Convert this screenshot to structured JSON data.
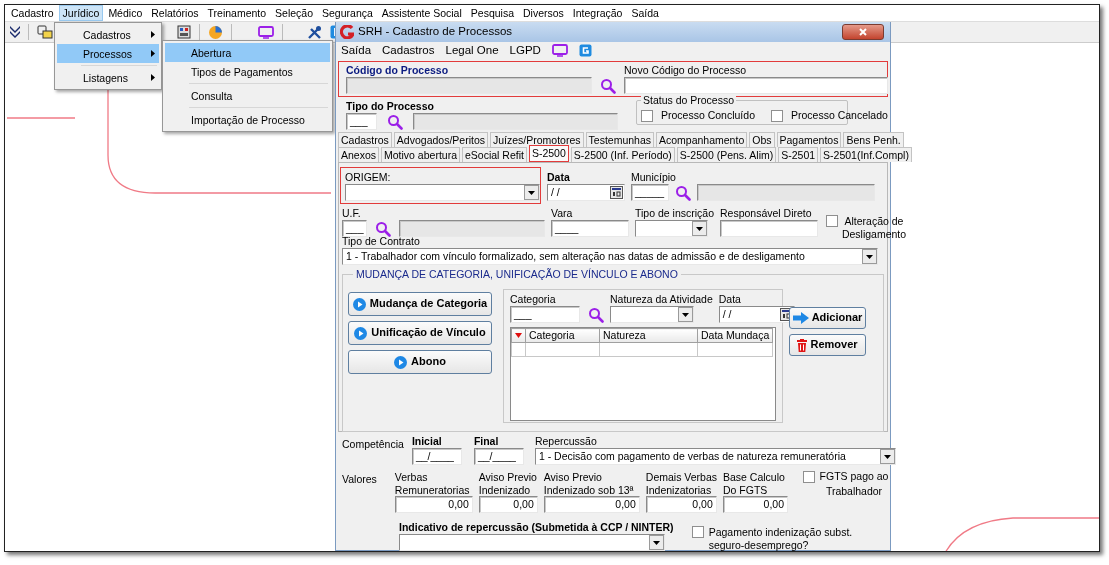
{
  "menubar": [
    {
      "label": "Cadastro",
      "selected": false
    },
    {
      "label": "Jurídico",
      "selected": true
    },
    {
      "label": "Médico",
      "selected": false
    },
    {
      "label": "Relatórios",
      "selected": false
    },
    {
      "label": "Treinamento",
      "selected": false
    },
    {
      "label": "Seleção",
      "selected": false
    },
    {
      "label": "Segurança",
      "selected": false
    },
    {
      "label": "Assistente Social",
      "selected": false
    },
    {
      "label": "Pesquisa",
      "selected": false
    },
    {
      "label": "Diversos",
      "selected": false
    },
    {
      "label": "Integração",
      "selected": false
    },
    {
      "label": "Saída",
      "selected": false
    }
  ],
  "menu": {
    "items": [
      {
        "kind": "item",
        "label": "Cadastros",
        "selected": false
      },
      {
        "kind": "item",
        "label": "Processos",
        "selected": true
      },
      {
        "kind": "separator"
      },
      {
        "kind": "item",
        "label": "Listagens",
        "selected": false
      }
    ]
  },
  "submenu": {
    "items": [
      {
        "kind": "item",
        "label": "Abertura",
        "selected": true
      },
      {
        "kind": "item",
        "label": "Tipos de Pagamentos",
        "selected": false
      },
      {
        "kind": "separator"
      },
      {
        "kind": "item",
        "label": "Consulta",
        "selected": false
      },
      {
        "kind": "separator"
      },
      {
        "kind": "item",
        "label": "Importação de Processo",
        "selected": false
      }
    ]
  },
  "dialog": {
    "title": "SRH - Cadastro de Processos",
    "menu": [
      "Saída",
      "Cadastros",
      "Legal One",
      "LGPD"
    ],
    "codigo": {
      "label": "Código do Processo",
      "highlighted": true
    },
    "novo_codigo": {
      "label": "Novo Código do Processo"
    },
    "tipo_processo": {
      "label": "Tipo do Processo",
      "value": "___"
    },
    "status": {
      "title": "Status do Processo",
      "options": [
        {
          "label": "Processo Concluído",
          "checked": false
        },
        {
          "label": "Processo Cancelado",
          "checked": false
        }
      ]
    },
    "tab_rows": [
      {
        "tabs": [
          {
            "label": "Cadastros",
            "selected": false,
            "highlighted": false
          },
          {
            "label": "Advogados/Peritos",
            "selected": false,
            "highlighted": false
          },
          {
            "label": "Juízes/Promotores",
            "selected": false,
            "highlighted": false
          },
          {
            "label": "Testemunhas",
            "selected": false,
            "highlighted": false
          },
          {
            "label": "Acompanhamento",
            "selected": false,
            "highlighted": false
          },
          {
            "label": "Obs",
            "selected": false,
            "highlighted": false
          },
          {
            "label": "Pagamentos",
            "selected": false,
            "highlighted": false
          },
          {
            "label": "Bens Penh.",
            "selected": false,
            "highlighted": false
          }
        ]
      },
      {
        "tabs": [
          {
            "label": "Anexos",
            "selected": false,
            "highlighted": false
          },
          {
            "label": "Motivo abertura",
            "selected": false,
            "highlighted": false
          },
          {
            "label": "eSocial Refit",
            "selected": false,
            "highlighted": false
          },
          {
            "label": "S-2500",
            "selected": true,
            "highlighted": true
          },
          {
            "label": "S-2500 (Inf. Período)",
            "selected": false,
            "highlighted": false
          },
          {
            "label": "S-2500 (Pens. Alim)",
            "selected": false,
            "highlighted": false
          },
          {
            "label": "S-2501",
            "selected": false,
            "highlighted": false
          },
          {
            "label": "S-2501(Inf.Compl)",
            "selected": false,
            "highlighted": false
          }
        ]
      }
    ],
    "origem": {
      "label": "ORIGEM:",
      "highlighted": true
    },
    "data": {
      "label": "Data",
      "value": "/ /"
    },
    "municipio": {
      "label": "Município",
      "value": "_____"
    },
    "uf": {
      "label": "U.F.",
      "value": "___"
    },
    "vara": {
      "label": "Vara",
      "value": "____"
    },
    "tipo_inscricao": {
      "label": "Tipo de inscrição"
    },
    "responsavel": {
      "label": "Responsável Direto"
    },
    "alteracao": {
      "label": "Alteração de Desligamento",
      "checked": false
    },
    "tipo_contrato": {
      "label": "Tipo de Contrato",
      "value": "1 - Trabalhador com vínculo formalizado, sem alteração nas datas de admissão e de desligamento"
    },
    "group": {
      "title": "MUDANÇA DE CATEGORIA, UNIFICAÇÃO DE VÍNCULO E ABONO",
      "buttons": [
        "Mudança de Categoria",
        "Unificação de Vínculo",
        "Abono"
      ],
      "categoria": {
        "label": "Categoria",
        "value": "___"
      },
      "natureza": {
        "label": "Natureza da Atividade"
      },
      "data": {
        "label": "Data",
        "value": "/ /"
      },
      "grid_columns": [
        "Categoria",
        "Natureza",
        "Data Mundaça"
      ],
      "actions": [
        {
          "label": "Adicionar",
          "kind": "add"
        },
        {
          "label": "Remover",
          "kind": "remove"
        }
      ]
    },
    "competencia": {
      "label": "Competência",
      "inicial": {
        "label": "Inicial",
        "value": "__/____"
      },
      "final": {
        "label": "Final",
        "value": "__/____"
      }
    },
    "repercussao": {
      "label": "Repercussão",
      "value": "1 - Decisão com pagamento de verbas de natureza remuneratória"
    },
    "valores": {
      "label": "Valores",
      "fields": [
        {
          "label": "Verbas\nRemuneratorias",
          "value": "0,00"
        },
        {
          "label": "Aviso Previo\nIndenizado",
          "value": "0,00"
        },
        {
          "label": "Aviso Previo\nIndenizado sob 13ª",
          "value": "0,00"
        },
        {
          "label": "Demais Verbas\nIndenizatorias",
          "value": "0,00"
        },
        {
          "label": "Base Calculo\nDo FGTS",
          "value": "0,00"
        }
      ]
    },
    "fgts": {
      "label": "FGTS pago ao Trabalhador",
      "checked": false
    },
    "indicativo": {
      "label": "Indicativo de repercussão (Submetida à CCP / NINTER)"
    },
    "pagamento": {
      "label": "Pagamento indenização subst. seguro-desemprego?",
      "checked": false
    }
  }
}
